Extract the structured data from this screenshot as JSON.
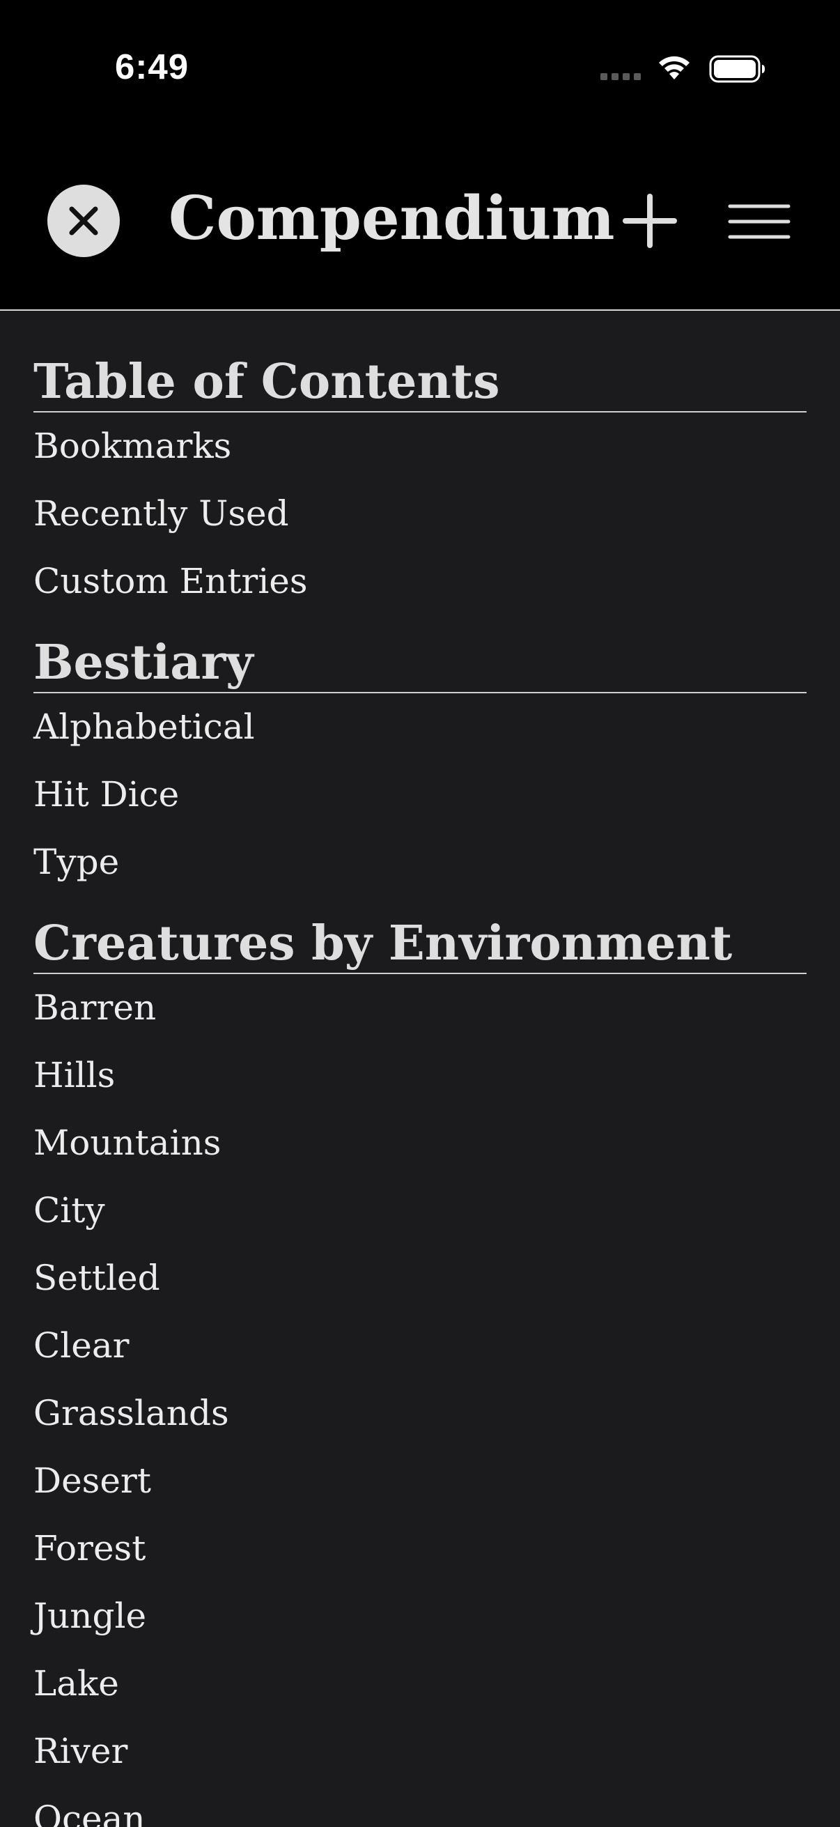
{
  "status_bar": {
    "time": "6:49",
    "wifi_icon": "wifi-icon",
    "battery_icon": "battery-icon"
  },
  "nav": {
    "title": "Compendium",
    "close_icon": "close-icon",
    "add_icon": "plus-icon",
    "menu_icon": "hamburger-menu-icon"
  },
  "sections": [
    {
      "title": "Table of Contents",
      "items": [
        "Bookmarks",
        "Recently Used",
        "Custom Entries"
      ]
    },
    {
      "title": "Bestiary",
      "items": [
        "Alphabetical",
        "Hit Dice",
        "Type"
      ]
    },
    {
      "title": "Creatures by Environment",
      "items": [
        "Barren",
        "Hills",
        "Mountains",
        "City",
        "Settled",
        "Clear",
        "Grasslands",
        "Desert",
        "Forest",
        "Jungle",
        "Lake",
        "River",
        "Ocean"
      ]
    }
  ],
  "colors": {
    "background": "#000000",
    "content_background": "#1b1b1d",
    "text": "#ececec",
    "header_text": "#dedede"
  }
}
